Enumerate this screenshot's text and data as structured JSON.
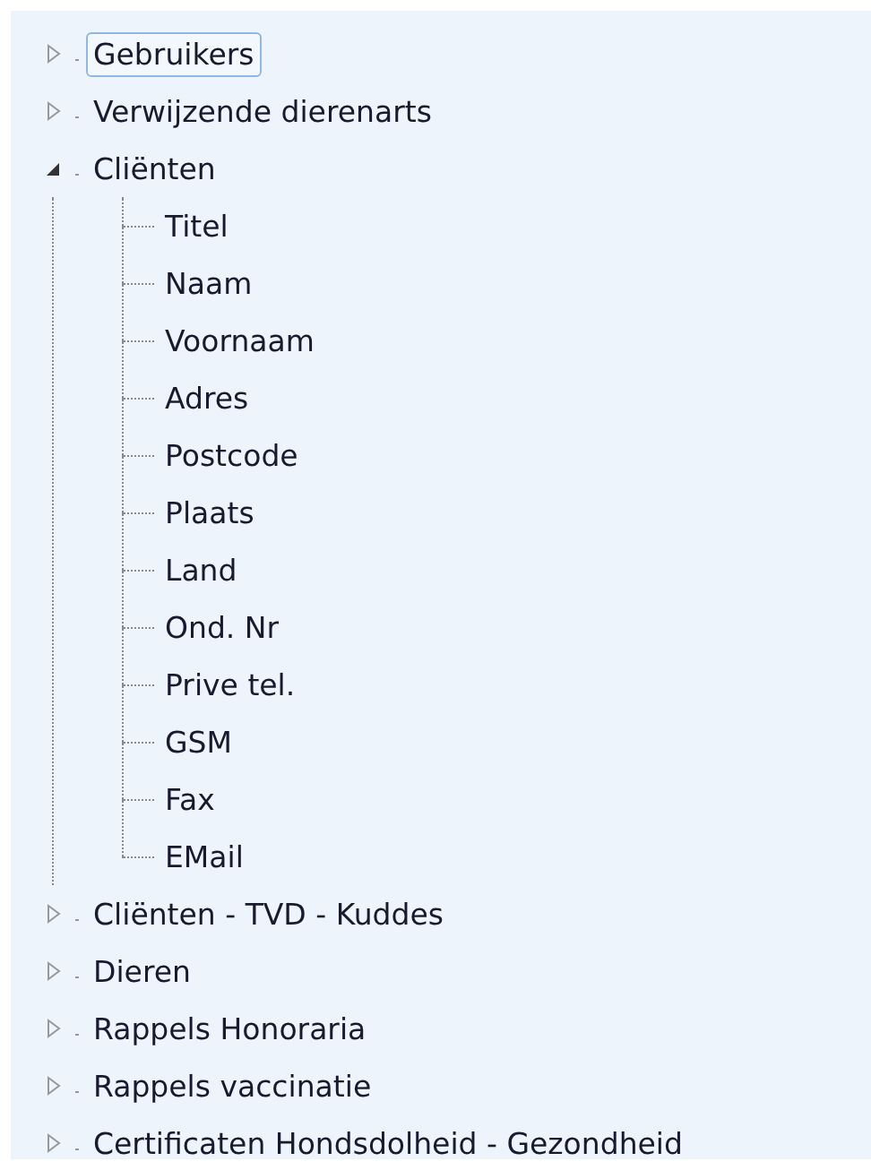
{
  "tree": [
    {
      "label": "Gebruikers",
      "expanded": false,
      "selected": true
    },
    {
      "label": "Verwijzende dierenarts",
      "expanded": false,
      "selected": false
    },
    {
      "label": "Cliënten",
      "expanded": true,
      "selected": false,
      "children": [
        {
          "label": "Titel",
          "selected": false
        },
        {
          "label": "Naam",
          "selected": false
        },
        {
          "label": "Voornaam",
          "selected": false
        },
        {
          "label": "Adres",
          "selected": false
        },
        {
          "label": "Postcode",
          "selected": false
        },
        {
          "label": "Plaats",
          "selected": false
        },
        {
          "label": "Land",
          "selected": false
        },
        {
          "label": "Ond. Nr",
          "selected": false
        },
        {
          "label": "Prive tel.",
          "selected": false
        },
        {
          "label": "GSM",
          "selected": false
        },
        {
          "label": "Fax",
          "selected": false
        },
        {
          "label": "EMail",
          "selected": false
        }
      ]
    },
    {
      "label": "Cliënten - TVD - Kuddes",
      "expanded": false,
      "selected": false
    },
    {
      "label": "Dieren",
      "expanded": false,
      "selected": false
    },
    {
      "label": "Rappels Honoraria",
      "expanded": false,
      "selected": false
    },
    {
      "label": "Rappels vaccinatie",
      "expanded": false,
      "selected": false
    },
    {
      "label": "Certificaten Hondsdolheid - Gezondheid",
      "expanded": false,
      "selected": false
    }
  ]
}
